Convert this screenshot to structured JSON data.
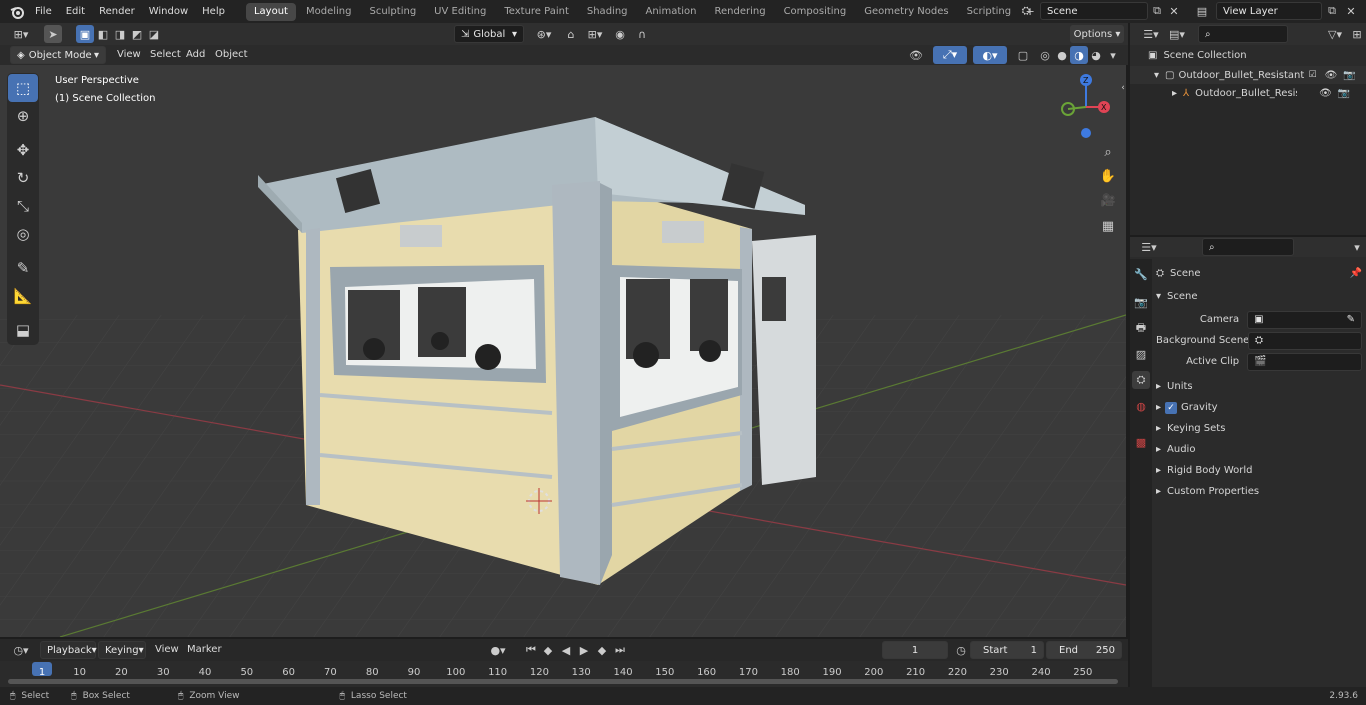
{
  "menu": {
    "file": "File",
    "edit": "Edit",
    "render": "Render",
    "window": "Window",
    "help": "Help"
  },
  "workspaces": [
    "Layout",
    "Modeling",
    "Sculpting",
    "UV Editing",
    "Texture Paint",
    "Shading",
    "Animation",
    "Rendering",
    "Compositing",
    "Geometry Nodes",
    "Scripting"
  ],
  "scene_field": "Scene",
  "view_layer_field": "View Layer",
  "viewport_header": {
    "mode": "Object Mode",
    "view": "View",
    "select": "Select",
    "add": "Add",
    "object": "Object",
    "orientation": "Global",
    "options": "Options"
  },
  "viewport": {
    "perspective": "User Perspective",
    "collection": "(1) Scene Collection",
    "gizmo": {
      "x": "X",
      "y": "Y",
      "z": "Z"
    }
  },
  "outliner": {
    "root": "Scene Collection",
    "items": [
      "Outdoor_Bullet_Resistant_Ser",
      "Outdoor_Bullet_Resistan"
    ]
  },
  "properties": {
    "title": "Scene",
    "section": "Scene",
    "camera_label": "Camera",
    "background_scene_label": "Background Scene",
    "active_clip_label": "Active Clip",
    "panels": [
      "Units",
      "Gravity",
      "Keying Sets",
      "Audio",
      "Rigid Body World",
      "Custom Properties"
    ]
  },
  "timeline": {
    "playback": "Playback",
    "keying": "Keying",
    "view": "View",
    "marker": "Marker",
    "current_frame": "1",
    "start_label": "Start",
    "start_value": "1",
    "end_label": "End",
    "end_value": "250",
    "ticks": [
      "1",
      "10",
      "20",
      "30",
      "40",
      "50",
      "60",
      "70",
      "80",
      "90",
      "100",
      "110",
      "120",
      "130",
      "140",
      "150",
      "160",
      "170",
      "180",
      "190",
      "200",
      "210",
      "220",
      "230",
      "240",
      "250"
    ]
  },
  "statusbar": {
    "select": "Select",
    "box_select": "Box Select",
    "zoom_view": "Zoom View",
    "lasso_select": "Lasso Select",
    "version": "2.93.6"
  },
  "colors": {
    "accent": "#4772b3",
    "x_axis": "#e04455",
    "y_axis": "#6aa337",
    "z_axis": "#3e7ae0"
  }
}
